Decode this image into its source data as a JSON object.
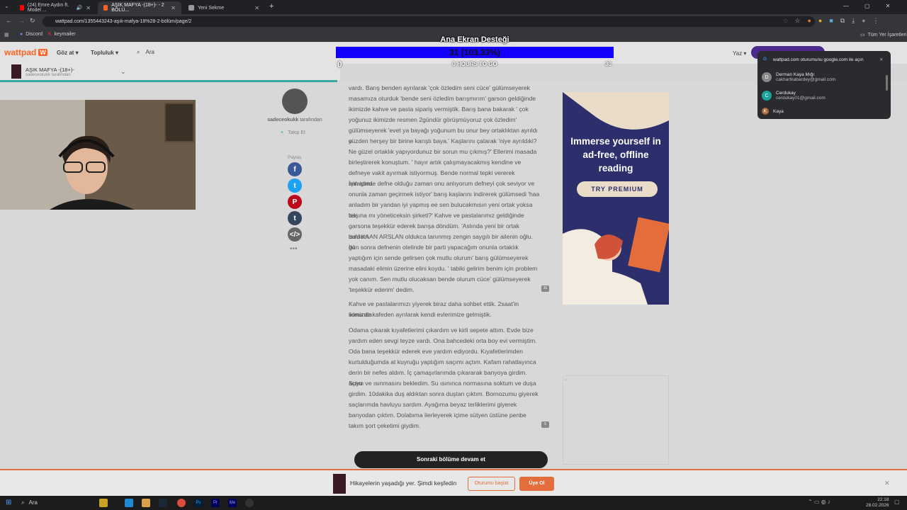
{
  "browser": {
    "tabs": [
      {
        "label": "(24) Emre Aydın ft. Model ...",
        "color": "#ff0000"
      },
      {
        "label": "AŞIK MAFYA -(18+)- - 2 BÖLÜ...",
        "color": "#ff6122"
      },
      {
        "label": "Yeni Sekme",
        "color": "#999999"
      }
    ],
    "url": "wattpad.com/1355443243-aşık-mafya-18%28-2-bölüm/page/2",
    "bookmarks": [
      "Discord",
      "keymailer"
    ],
    "bookmarks_right": "Tüm Yer İşaretleri",
    "window_controls": [
      "—",
      "▢",
      "✕"
    ]
  },
  "overlay": {
    "title": "Ana Ekran Desteği",
    "bar_text": "31 (103.33%)",
    "min": "0",
    "hours": "0 HOURS TO GO",
    "max": "30"
  },
  "wattpad": {
    "logo": "wattpad",
    "nav": [
      "Göz at",
      "Topluluk"
    ],
    "search_placeholder": "Ara",
    "write": "Yaz",
    "story_title": "AŞIK MAFYA -(18+)-",
    "story_author_line": "sadeceokukk tarafından"
  },
  "author": {
    "name": "sadeceokukk",
    "suffix": " tarafından",
    "follow": "Takip Et",
    "share_label": "Paylaş"
  },
  "paragraphs": [
    {
      "lines": [
        "vardı. Barış benden ayrılarak 'çok özledim seni cüce' gülümseyerek",
        "masamıza oturduk 'bende seni özledim barışmırım' garson geldiğinde",
        "ikimizde kahve ve pasta sipariş vermiştik. Barış bana bakarak ' çok",
        "yoğunuz ikimizde resmen 2gündür görüşmüyoruz çok özledim'",
        "gülümseyerek 'evet ya bayağı yoğunum bu onur bey ortaklıktan ayrıldı o",
        "yüzden herşey bir birine karıştı baya.' Kaşlarını çatarak 'niye ayrıldıki?",
        "Ne güzel ortaklık yapıyordunuz bir sorun mu çıkmış?' Ellerimi masada",
        "birleştirerek konuştum. ' hayır artık çalışmayacakmış kendine ve",
        "defneye vakit ayırmak istiyormuş. Bende normal tepki vererek anlaştım.",
        "İşin içinde defne olduğu zaman onu anlıyorum defneyi çok seviyor ve",
        "onunla zaman geçirmek istiyor'  barış kaşlarını indirerek gülümsedi 'haa",
        "anladım bir yandan iyi yapmış ee sen bulucakmısın yeni ortak yoksa tek",
        "başına mı yöneticeksin şirketi?' Kahve ve pastalarımız geldiğinde",
        "garsona teşekkür ederek barışa döndüm. 'Aslında yeni bir ortak buldum",
        "ismi KAAN ARSLAN oldukca tanınmış zengin saygılı bir ailenin oğlu. İki",
        "gün sonra defnenin otelinde bir parti yapacağım onunla ortaklık",
        "yaptığım için sende gelirsen çok mutlu olurum' barış gülümseyerek",
        "masadaki elimin üzerine elini koydu. ' tabiki gelirim benim için problem",
        "yok canım. Sen mutlu olucaksan bende olurum cüce' gülümseyerek",
        "'teşekkür ederim' dedim."
      ],
      "comments": "31"
    },
    {
      "lines": [
        "Kahve ve pastalarımızı yiyerek biraz daha sohbet ettik. 2saat'in sonunda",
        "ikimizde kafeden ayrılarak kendi evlerimize gelmiştik."
      ]
    },
    {
      "lines": [
        "Odama çıkarak kıyafetlerimi çıkardım ve kirli sepete attım. Evde bize",
        "yardım eden sevgi teyze vardı. Ona bahcedeki orta boy evi vermiştim.",
        "Oda bana teşekkür ederek eve yardım ediyordu. Kıyafetlerimden",
        "kurtulduğumda at kuyruğu yaptığım saçımı açtım. Kafam rahatlayınca",
        "derin bir nefes aldım. İç çamaşırlarımda çıkararak banyoya girdim. Suyu",
        "açtım ve ısınmasını bekledim. Su ısınınca normasına soktum ve duşa",
        "girdim. 10dakika duş aldıktan sonra duştan çıktım. Bornozumu giyerek",
        "saçlarımda havluyu sardım. Ayağıma beyaz terliklerimi giyerek",
        "banyodan çıktım. Dolabıma ilerleyerek içime sütyen üstüne penbe",
        "takım şort çeketimi giydim."
      ],
      "comments": "5"
    }
  ],
  "next_button": "Sonraki bölüme devam et",
  "ad": {
    "headline": "Immerse yourself in ad-free, offline reading",
    "cta": "TRY PREMIUM"
  },
  "banner": {
    "text": "Hikayelerin yaşadığı yer. Şimdi keşfedin",
    "login": "Oturumu başlat",
    "signup": "Üye Ol"
  },
  "google_popup": {
    "title": "wattpad.com oturumunu google.com ile açın",
    "accounts": [
      {
        "name": "Derman Kaya Mığı",
        "email": "cakhartkabardey@gmail.com",
        "initial": "D",
        "color": "#888888"
      },
      {
        "name": "Cerdukay",
        "email": "cerdukay01@gmail.com",
        "initial": "C",
        "color": "#1aa39a"
      },
      {
        "name": "Kaya",
        "email": "",
        "initial": "K",
        "color": "#aa6633"
      }
    ]
  },
  "taskbar": {
    "search": "Ara",
    "time": "22:18",
    "date": "28.02.2026"
  }
}
